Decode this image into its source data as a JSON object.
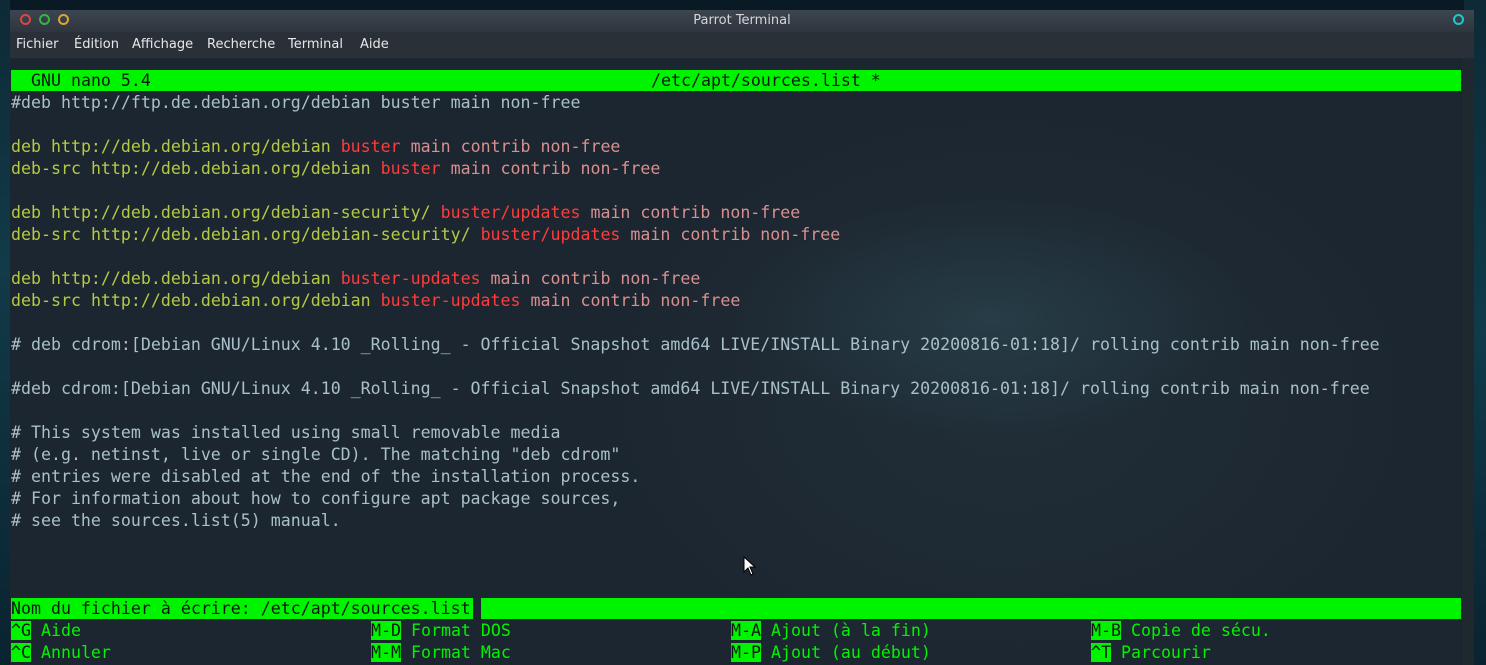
{
  "window": {
    "title": "Parrot Terminal"
  },
  "menu": [
    "Fichier",
    "Édition",
    "Affichage",
    "Recherche",
    "Terminal",
    "Aide"
  ],
  "nano": {
    "version": "GNU nano 5.4",
    "filename": "/etc/apt/sources.list *"
  },
  "lines": [
    {
      "id": "l1",
      "parts": [
        [
          "c-comment",
          "#deb http://ftp.de.debian.org/debian buster main non-free"
        ]
      ]
    },
    {
      "id": "l2",
      "parts": [
        [
          "c-deb",
          "deb "
        ],
        [
          "c-url",
          "http://deb.debian.org/debian "
        ],
        [
          "c-dist",
          "buster"
        ],
        [
          "c-comp",
          " main contrib non-free"
        ]
      ]
    },
    {
      "id": "l3",
      "parts": [
        [
          "c-deb",
          "deb-src "
        ],
        [
          "c-url",
          "http://deb.debian.org/debian "
        ],
        [
          "c-dist",
          "buster"
        ],
        [
          "c-comp",
          " main contrib non-free"
        ]
      ]
    },
    {
      "id": "l4",
      "parts": [
        [
          "c-deb",
          "deb "
        ],
        [
          "c-url",
          "http://deb.debian.org/debian-security/ "
        ],
        [
          "c-dist",
          "buster/updates"
        ],
        [
          "c-comp",
          " main contrib non-free"
        ]
      ]
    },
    {
      "id": "l5",
      "parts": [
        [
          "c-deb",
          "deb-src "
        ],
        [
          "c-url",
          "http://deb.debian.org/debian-security/ "
        ],
        [
          "c-dist",
          "buster/updates"
        ],
        [
          "c-comp",
          " main contrib non-free"
        ]
      ]
    },
    {
      "id": "l6",
      "parts": [
        [
          "c-deb",
          "deb "
        ],
        [
          "c-url",
          "http://deb.debian.org/debian "
        ],
        [
          "c-dist",
          "buster-updates"
        ],
        [
          "c-comp",
          " main contrib non-free"
        ]
      ]
    },
    {
      "id": "l7",
      "parts": [
        [
          "c-deb",
          "deb-src "
        ],
        [
          "c-url",
          "http://deb.debian.org/debian "
        ],
        [
          "c-dist",
          "buster-updates"
        ],
        [
          "c-comp",
          " main contrib non-free"
        ]
      ]
    },
    {
      "id": "l8",
      "parts": [
        [
          "c-comment",
          "# deb cdrom:[Debian GNU/Linux 4.10 _Rolling_ - Official Snapshot amd64 LIVE/INSTALL Binary 20200816-01:18]/ rolling contrib main non-free"
        ]
      ]
    },
    {
      "id": "l9",
      "parts": [
        [
          "c-comment",
          "#deb cdrom:[Debian GNU/Linux 4.10 _Rolling_ - Official Snapshot amd64 LIVE/INSTALL Binary 20200816-01:18]/ rolling contrib main non-free"
        ]
      ]
    },
    {
      "id": "l10",
      "parts": [
        [
          "c-comment",
          "# This system was installed using small removable media"
        ]
      ]
    },
    {
      "id": "l11",
      "parts": [
        [
          "c-comment",
          "# (e.g. netinst, live or single CD). The matching \"deb cdrom\""
        ]
      ]
    },
    {
      "id": "l12",
      "parts": [
        [
          "c-comment",
          "# entries were disabled at the end of the installation process."
        ]
      ]
    },
    {
      "id": "l13",
      "parts": [
        [
          "c-comment",
          "# For information about how to configure apt package sources,"
        ]
      ]
    },
    {
      "id": "l14",
      "parts": [
        [
          "c-comment",
          "# see the sources.list(5) manual."
        ]
      ]
    }
  ],
  "prompt": {
    "label": "Nom du fichier à écrire: /etc/apt/sources.list",
    "value": ""
  },
  "shortcuts": [
    {
      "key": "^G",
      "label": "Aide"
    },
    {
      "key": "M-D",
      "label": "Format DOS"
    },
    {
      "key": "M-A",
      "label": "Ajout (à la fin)"
    },
    {
      "key": "M-B",
      "label": "Copie de sécu."
    },
    {
      "key": "^C",
      "label": "Annuler"
    },
    {
      "key": "M-M",
      "label": "Format Mac"
    },
    {
      "key": "M-P",
      "label": "Ajout (au début)"
    },
    {
      "key": "^T",
      "label": "Parcourir"
    }
  ],
  "colors": {
    "nano_bar": "#00f400",
    "distribution": "#ff3b3b",
    "keyword": "#b5c943",
    "comment": "#a9c0c8"
  },
  "icons": [
    "close-icon",
    "minimize-icon",
    "maximize-icon",
    "window-option-icon",
    "mouse-cursor-icon"
  ]
}
